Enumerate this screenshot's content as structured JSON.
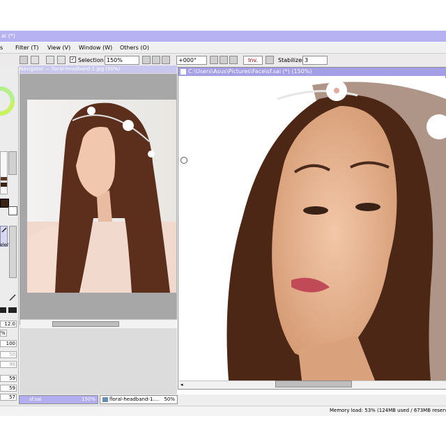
{
  "window": {
    "title": "ai (*)"
  },
  "menu": {
    "items": [
      "s",
      "Filter (T)",
      "View (V)",
      "Window (W)",
      "Others (O)"
    ]
  },
  "toolbar": {
    "selection_label": "Selection",
    "selection_checked": true,
    "zoom_value": "150%",
    "rotation_value": "+000°",
    "invert_label": "Inv.",
    "stabilizer_label": "Stabilizer",
    "stabilizer_value": "3"
  },
  "left_panel": {
    "brush_size_value": "12.0",
    "percent_value": "%",
    "density_value": "100",
    "field_50": "50",
    "field_98": "98",
    "field_59a": "59",
    "field_59b": "59",
    "field_57": "57",
    "tool_label": "elect"
  },
  "navigator": {
    "title": "Navigator — floral-headband-1.jpg (50%)"
  },
  "canvas": {
    "title": "C:\\Users\\Asus\\Pictures\\Face\\sf.sai (*) (150%)"
  },
  "tabs": [
    {
      "name": "sf.sai",
      "zoom": "150%"
    },
    {
      "name": "floral-headband-1....",
      "zoom": "50%"
    }
  ],
  "status": {
    "memory": "Memory load: 53% (124MB used / 673MB reserv"
  },
  "colors": {
    "title_accent": "#a49ee6",
    "tab_active": "#b3aef0"
  },
  "icons": [
    "brush-icon",
    "pen-icon",
    "color-wheel-icon",
    "scroll-arrow-left-icon"
  ]
}
